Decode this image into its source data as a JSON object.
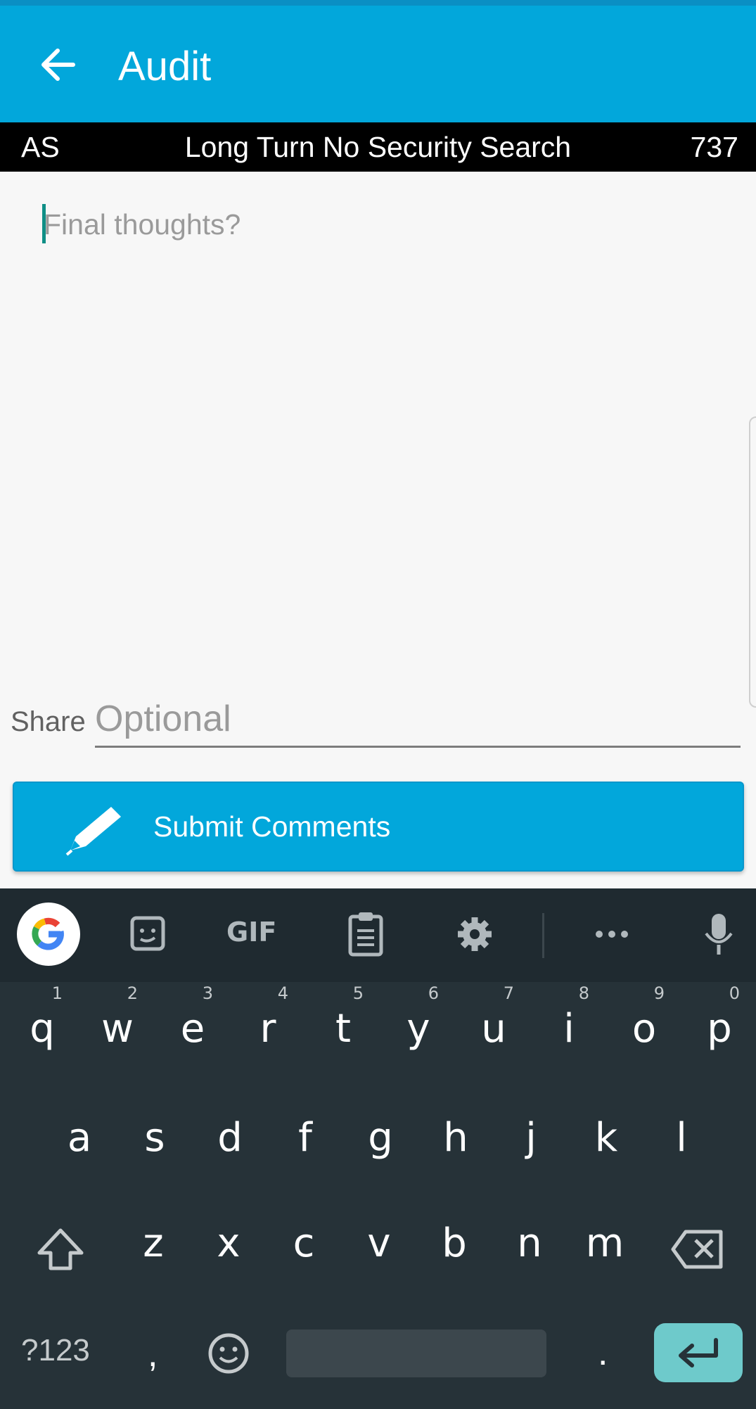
{
  "app": {
    "title": "Audit",
    "back_icon": "arrow-left-icon",
    "colors": {
      "appbar": "#02a7db",
      "infobar": "#000000",
      "keyboard": "#263238",
      "enter_key": "#6ecacb"
    }
  },
  "infobar": {
    "left": "AS",
    "center": "Long Turn No Security Search",
    "right": "737"
  },
  "comment": {
    "placeholder": "Final thoughts?"
  },
  "share": {
    "label": "Share",
    "placeholder": "Optional"
  },
  "submit": {
    "label": "Submit Comments",
    "icon": "pencil-icon"
  },
  "keyboard": {
    "toolbar": [
      "google-icon",
      "sticker-icon",
      "gif-icon",
      "clipboard-icon",
      "gear-icon",
      "more-icon",
      "mic-icon"
    ],
    "gif_label": "GIF",
    "row1": [
      "q",
      "w",
      "e",
      "r",
      "t",
      "y",
      "u",
      "i",
      "o",
      "p"
    ],
    "row1_hints": [
      "1",
      "2",
      "3",
      "4",
      "5",
      "6",
      "7",
      "8",
      "9",
      "0"
    ],
    "row2": [
      "a",
      "s",
      "d",
      "f",
      "g",
      "h",
      "j",
      "k",
      "l"
    ],
    "row3": [
      "z",
      "x",
      "c",
      "v",
      "b",
      "n",
      "m"
    ],
    "symbols_label": "?123",
    "comma": ",",
    "period": "."
  }
}
